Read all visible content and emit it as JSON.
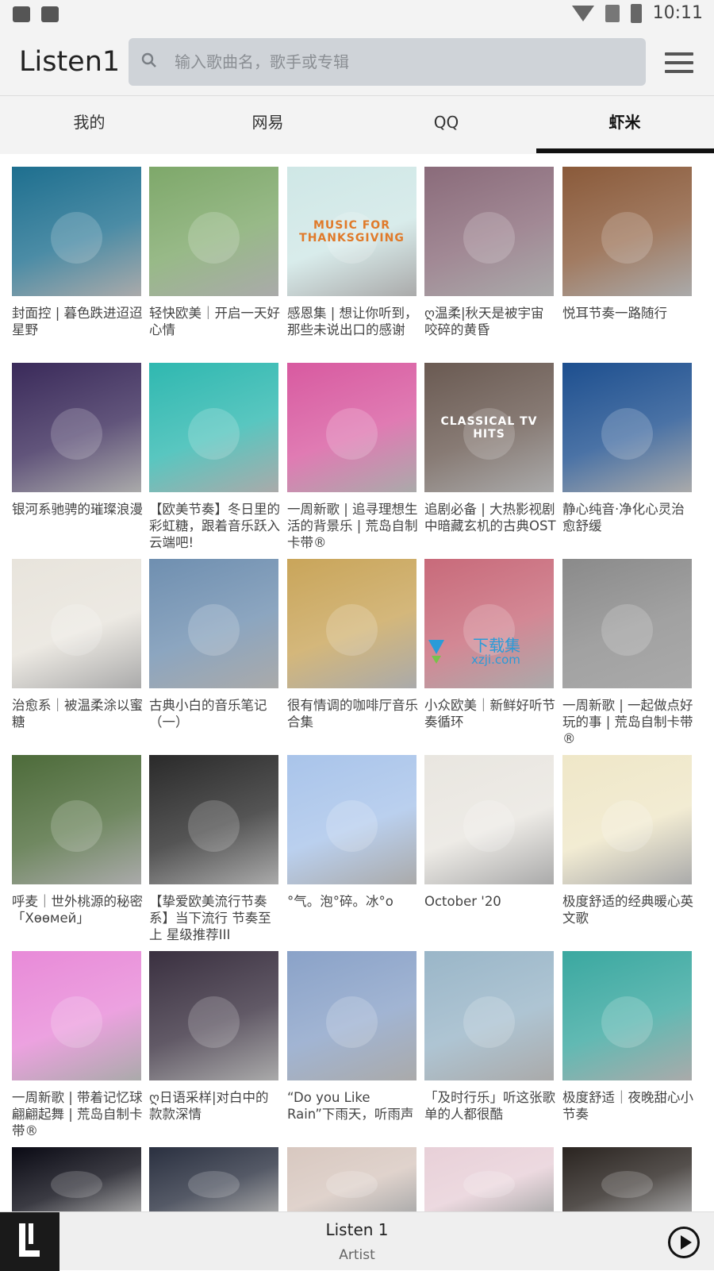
{
  "status_bar": {
    "time": "10:11"
  },
  "app": {
    "title": "Listen1"
  },
  "search": {
    "placeholder": "输入歌曲名，歌手或专辑",
    "value": ""
  },
  "tabs": [
    {
      "label": "我的",
      "active": false
    },
    {
      "label": "网易",
      "active": false
    },
    {
      "label": "QQ",
      "active": false
    },
    {
      "label": "虾米",
      "active": true
    }
  ],
  "playlists": [
    {
      "title": "封面控 | 暮色跌进迢迢星野",
      "cover_color": "#1e6f8f"
    },
    {
      "title": "轻快欧美｜开启一天好心情",
      "cover_color": "#7ea86a"
    },
    {
      "title": "感恩集 | 想让你听到，那些未说出口的感谢",
      "cover_color": "#cfe7e6",
      "cover_text": "MUSIC FOR THANKSGIVING"
    },
    {
      "title": "ღ温柔|秋天是被宇宙咬碎的黄昏",
      "cover_color": "#8a6b7a"
    },
    {
      "title": "悦耳节奏一路随行",
      "cover_color": "#8a5a3a"
    },
    {
      "title": "银河系驰骋的璀璨浪漫",
      "cover_color": "#3a2a5a"
    },
    {
      "title": "【欧美节奏】冬日里的彩虹糖，跟着音乐跃入云端吧!",
      "cover_color": "#2fb8b0"
    },
    {
      "title": "一周新歌 | 追寻理想生活的背景乐 | 荒岛自制卡带®",
      "cover_color": "#d85aa0"
    },
    {
      "title": "追剧必备 | 大热影视剧中暗藏玄机的古典OST",
      "cover_color": "#6a5a52",
      "cover_text": "CLASSICAL TV HITS"
    },
    {
      "title": "静心纯音·净化心灵治愈舒缓",
      "cover_color": "#1d4f8f"
    },
    {
      "title": "治愈系｜被温柔涂以蜜糖",
      "cover_color": "#e8e4dc"
    },
    {
      "title": "古典小白的音乐笔记（一）",
      "cover_color": "#6f8fb0"
    },
    {
      "title": "很有情调的咖啡厅音乐合集",
      "cover_color": "#c9a55a"
    },
    {
      "title": "小众欧美｜新鲜好听节奏循环",
      "cover_color": "#c86a7a"
    },
    {
      "title": "一周新歌 | 一起做点好玩的事 | 荒岛自制卡带®",
      "cover_color": "#8a8a8a"
    },
    {
      "title": "呼麦｜世外桃源的秘密「Хөөмей」",
      "cover_color": "#4d6b3a"
    },
    {
      "title": "【挚爱欧美流行节奏系】当下流行 节奏至上 星级推荐III",
      "cover_color": "#2a2a2a"
    },
    {
      "title": "°气。泡°碎。冰°o",
      "cover_color": "#a9c4ea"
    },
    {
      "title": "October '20",
      "cover_color": "#e9e6e0"
    },
    {
      "title": "极度舒适的经典暖心英文歌",
      "cover_color": "#efe7c8"
    },
    {
      "title": "一周新歌 | 带着记忆球翩翩起舞 | 荒岛自制卡带®",
      "cover_color": "#e88ad8"
    },
    {
      "title": "ღ日语采样|对白中的款款深情",
      "cover_color": "#3a3040"
    },
    {
      "title": "“Do you Like Rain”下雨天，听雨声",
      "cover_color": "#8aa2c8"
    },
    {
      "title": "「及时行乐」听这张歌单的人都很酷",
      "cover_color": "#9ab6c8"
    },
    {
      "title": "极度舒适｜夜晚甜心小节奏",
      "cover_color": "#3aa8a0"
    },
    {
      "title": "",
      "cover_color": "#0a0a14"
    },
    {
      "title": "",
      "cover_color": "#2a3040"
    },
    {
      "title": "",
      "cover_color": "#d8c8c0"
    },
    {
      "title": "",
      "cover_color": "#e8d0d8"
    },
    {
      "title": "",
      "cover_color": "#2a2420"
    }
  ],
  "player": {
    "title": "Listen 1",
    "artist": "Artist"
  },
  "watermark": {
    "text": "下载集",
    "sub": "xzji.com"
  }
}
